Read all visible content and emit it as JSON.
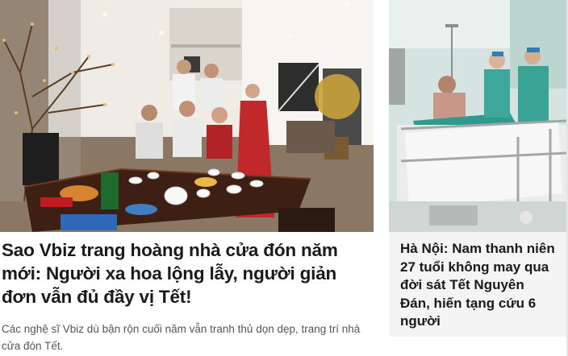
{
  "main_article": {
    "image_icon": "family-new-year-photo",
    "title": "Sao Vbiz trang hoàng nhà cửa đón năm mới: Người xa hoa lộng lẫy, người giản đơn vẫn đủ đầy vị Tết!",
    "sapo": "Các nghệ sĩ Vbiz dù bận rộn cuối năm vẫn tranh thủ dọn dẹp, trang trí nhà cửa đón Tết."
  },
  "side_article": {
    "image_icon": "hospital-ward-photo",
    "title": "Hà Nội: Nam thanh niên 27 tuổi không may qua đời sát Tết Nguyên Đán, hiến tạng cứu 6 người"
  },
  "colors": {
    "title_text": "#1a1a1a",
    "sapo_text": "#555555",
    "side_box_bg": "#f4f4f4"
  }
}
